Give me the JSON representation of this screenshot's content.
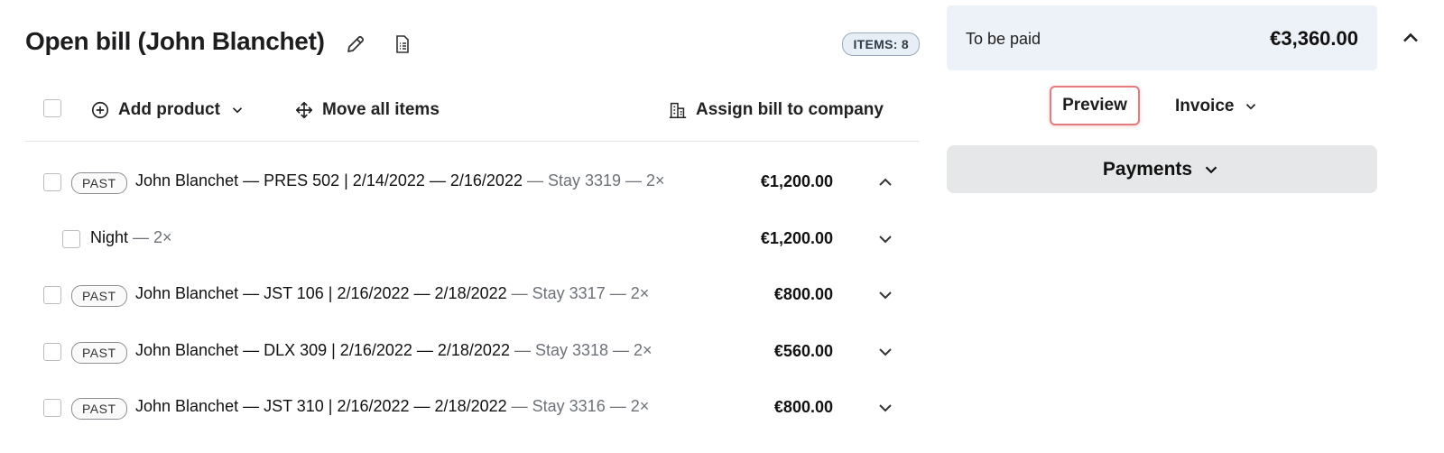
{
  "header": {
    "title": "Open bill (John Blanchet)",
    "items_badge": "ITEMS: 8",
    "edit_icon": "pencil-icon",
    "document_icon": "document-list-icon"
  },
  "toolbar": {
    "add_product_label": "Add product",
    "move_all_label": "Move all items",
    "assign_label": "Assign bill to company"
  },
  "rows": [
    {
      "badge": "PAST",
      "main": "John Blanchet — PRES 502 | 2/14/2022 — 2/16/2022",
      "extra": " — Stay 3319 — 2×",
      "amount": "€1,200.00",
      "expanded": true
    },
    {
      "badge": "",
      "main": "Night",
      "extra": " — 2×",
      "amount": "€1,200.00",
      "expanded": false
    },
    {
      "badge": "PAST",
      "main": "John Blanchet — JST 106 | 2/16/2022 — 2/18/2022",
      "extra": " — Stay 3317 — 2×",
      "amount": "€800.00",
      "expanded": false
    },
    {
      "badge": "PAST",
      "main": "John Blanchet — DLX 309 | 2/16/2022 — 2/18/2022",
      "extra": " — Stay 3318 — 2×",
      "amount": "€560.00",
      "expanded": false
    },
    {
      "badge": "PAST",
      "main": "John Blanchet — JST 310 | 2/16/2022 — 2/18/2022",
      "extra": " — Stay 3316 — 2×",
      "amount": "€800.00",
      "expanded": false
    }
  ],
  "summary": {
    "to_be_paid_label": "To be paid",
    "to_be_paid_value": "€3,360.00",
    "preview_label": "Preview",
    "invoice_label": "Invoice",
    "payments_label": "Payments"
  },
  "colors": {
    "highlight_border": "#e57b7b",
    "summary_bg": "#edf1f8",
    "payments_bg": "#e6e7e8"
  }
}
